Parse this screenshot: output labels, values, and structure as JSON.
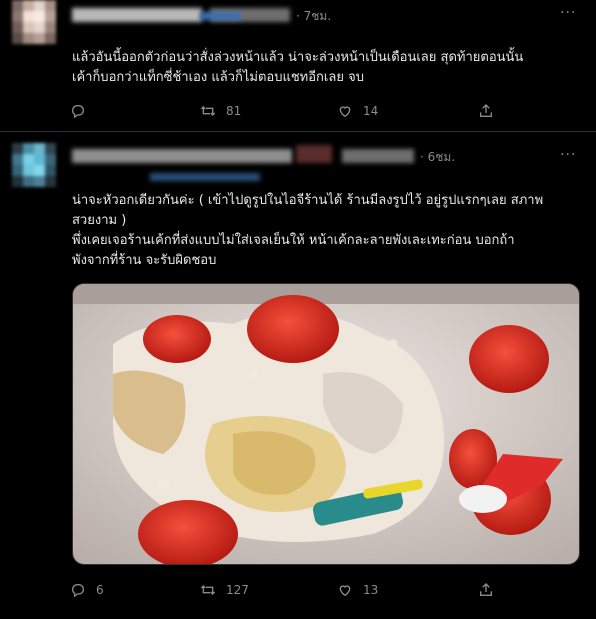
{
  "tweets": [
    {
      "time": "· 7ชม.",
      "more": "···",
      "text": "แล้วอันนี้ออกตัวก่อนว่าสั่งล่วงหน้าแล้ว น่าจะล่วงหน้าเป็นเดือนเลย สุดท้ายตอนนั้น\nเค้าก็บอกว่าแท็กซี่ช้าเอง แล้วก็ไม่ตอบแชทอีกเลย จบ",
      "replies": "",
      "retweets": "81",
      "likes": "14",
      "icons": [
        "reply-icon",
        "retweet-icon",
        "like-icon",
        "share-icon"
      ]
    },
    {
      "time": "· 6ชม.",
      "more": "···",
      "text": "น่าจะหัวอกเดียวกันค่ะ ( เข้าไปดูรูปในไอจีร้านได้ ร้านมีลงรูปไว้ อยู่รูปแรกๆเลย สภาพ\nสวยงาม )\nพึ่งเคยเจอร้านเค้กที่ส่งแบบไม่ใส่เจลเย็นให้ หน้าเค้กละลายพังเละเทะก่อน บอกถ้า\nพังจากที่ร้าน จะรับผิดชอบ",
      "replies": "6",
      "retweets": "127",
      "likes": "13",
      "media": "damaged strawberry cake photo",
      "icons": [
        "reply-icon",
        "retweet-icon",
        "like-icon",
        "share-icon"
      ]
    }
  ],
  "colors": {
    "background": "#000000",
    "text": "#e7e9ea",
    "secondary": "#8b8b8b",
    "divider": "#2f3336"
  }
}
